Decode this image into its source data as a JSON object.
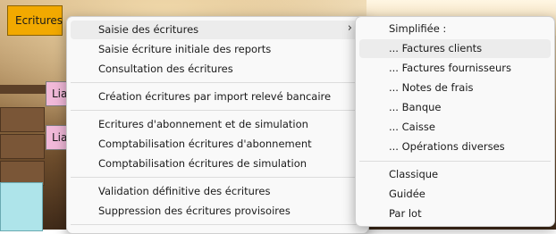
{
  "tab": {
    "label": "Ecritures"
  },
  "side_buttons": [
    "Lia",
    "Lia"
  ],
  "main_menu": {
    "items": [
      {
        "label": "Saisie des écritures",
        "submenu": true
      },
      {
        "label": "Saisie écriture initiale des reports"
      },
      {
        "label": "Consultation des écritures"
      },
      {
        "label": "Création écritures par import relevé bancaire"
      },
      {
        "label": "Ecritures d'abonnement et de simulation"
      },
      {
        "label": "Comptabilisation écritures d'abonnement"
      },
      {
        "label": "Comptabilisation écritures de simulation"
      },
      {
        "label": "Validation définitive des écritures"
      },
      {
        "label": "Suppression des écritures provisoires"
      }
    ],
    "submenu_arrow": "chevron-right-icon"
  },
  "sub_menu": {
    "header": "Simplifiée :",
    "items": [
      {
        "label": "... Factures clients",
        "highlighted": true
      },
      {
        "label": "... Factures fournisseurs"
      },
      {
        "label": "... Notes de frais"
      },
      {
        "label": "... Banque"
      },
      {
        "label": "... Caisse"
      },
      {
        "label": "... Opérations diverses"
      },
      {
        "label": "Classique"
      },
      {
        "label": "Guidée"
      },
      {
        "label": "Par lot"
      }
    ]
  },
  "colors": {
    "tab": "#f2a900",
    "lia_button": "#f1b9d9",
    "menu_bg": "#f9f9f9",
    "highlight": "#ececec"
  }
}
